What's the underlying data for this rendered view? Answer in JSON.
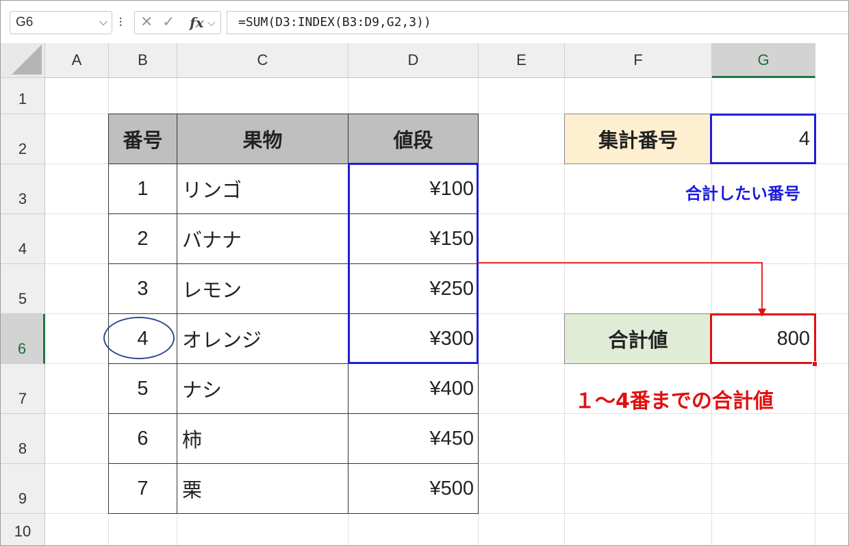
{
  "formula_bar": {
    "name_box": "G6",
    "formula": "=SUM(D3:INDEX(B3:D9,G2,3))",
    "fx_label": "fx"
  },
  "columns": [
    "A",
    "B",
    "C",
    "D",
    "E",
    "F",
    "G"
  ],
  "active_column": "G",
  "rows": [
    "1",
    "2",
    "3",
    "4",
    "5",
    "6",
    "7",
    "8",
    "9",
    "10"
  ],
  "active_row": "6",
  "table": {
    "headers": [
      "番号",
      "果物",
      "値段"
    ],
    "rows": [
      {
        "no": "1",
        "fruit": "リンゴ",
        "price": "¥100"
      },
      {
        "no": "2",
        "fruit": "バナナ",
        "price": "¥150"
      },
      {
        "no": "3",
        "fruit": "レモン",
        "price": "¥250"
      },
      {
        "no": "4",
        "fruit": "オレンジ",
        "price": "¥300"
      },
      {
        "no": "5",
        "fruit": "ナシ",
        "price": "¥400"
      },
      {
        "no": "6",
        "fruit": "柿",
        "price": "¥450"
      },
      {
        "no": "7",
        "fruit": "栗",
        "price": "¥500"
      }
    ]
  },
  "lookup": {
    "label": "集計番号",
    "value": "4",
    "note": "合計したい番号"
  },
  "result": {
    "label": "合計値",
    "value": "800",
    "note": "１～4番までの合計値"
  },
  "colors": {
    "header_fill": "#bfbfbf",
    "label_orange": "#fdefcf",
    "label_green": "#e1ecd6",
    "highlight_blue": "#1d1ed6",
    "highlight_red": "#e01010",
    "excel_green": "#217346"
  }
}
